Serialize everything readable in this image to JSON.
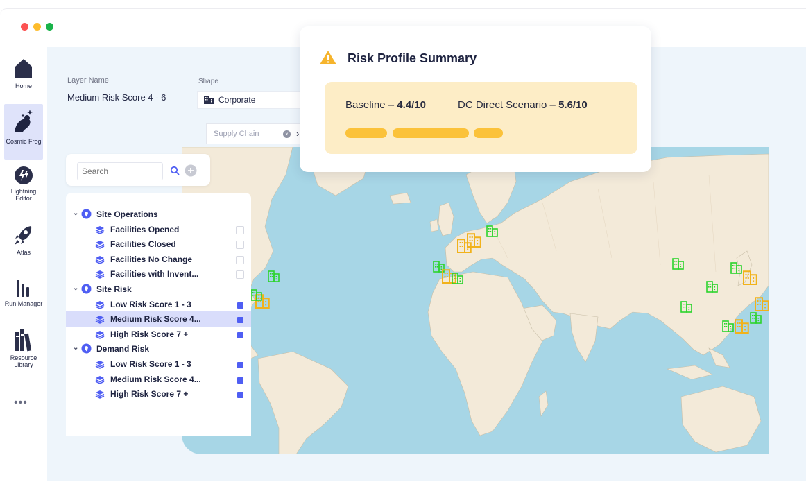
{
  "window": {
    "controls": [
      "close",
      "minimize",
      "maximize"
    ]
  },
  "colors": {
    "accent": "#4f5ef3",
    "warning": "#f6b42c",
    "risk_high": "#f1b21b",
    "risk_low": "#2bd42b",
    "summary_bg": "#fdedc6"
  },
  "sidebar": {
    "items": [
      {
        "label": "Home",
        "icon": "home-icon"
      },
      {
        "label": "Cosmic Frog",
        "icon": "cosmic-frog-icon",
        "active": true
      },
      {
        "label": "Lightning Editor",
        "icon": "lightning-icon"
      },
      {
        "label": "Atlas",
        "icon": "rocket-icon"
      },
      {
        "label": "Run Manager",
        "icon": "bar-chart-icon"
      },
      {
        "label": "Resource Library",
        "icon": "books-icon"
      }
    ],
    "more": "•••"
  },
  "layer_form": {
    "layer_name_label": "Layer Name",
    "layer_name_value": "Medium Risk Score 4 - 6",
    "shape_label": "Shape",
    "shape_value": "Corporate",
    "filter_chip": "Supply Chain"
  },
  "search": {
    "placeholder": "Search",
    "value": "Search"
  },
  "layers": {
    "groups": [
      {
        "label": "Site Operations",
        "items": [
          {
            "label": "Facilities Opened",
            "checked": false
          },
          {
            "label": "Facilities Closed",
            "checked": false
          },
          {
            "label": "Facilities No Change",
            "checked": false
          },
          {
            "label": "Facilities with Invent...",
            "checked": false
          }
        ]
      },
      {
        "label": "Site Risk",
        "items": [
          {
            "label": "Low Risk Score 1 - 3",
            "checked": true
          },
          {
            "label": "Medium Risk Score 4...",
            "checked": true,
            "selected": true
          },
          {
            "label": "High Risk Score 7 +",
            "checked": true
          }
        ]
      },
      {
        "label": "Demand Risk",
        "items": [
          {
            "label": "Low Risk Score 1 - 3",
            "checked": true
          },
          {
            "label": "Medium Risk Score 4...",
            "checked": true
          },
          {
            "label": "High Risk Score 7 +",
            "checked": true
          }
        ]
      }
    ]
  },
  "popup": {
    "title": "Risk Profile Summary",
    "baseline_label": "Baseline –",
    "baseline_value": "4.4/10",
    "scenario_label": "DC Direct Scenario –",
    "scenario_value": "5.6/10"
  },
  "map": {
    "markers": [
      {
        "region": "Europe",
        "risk": "low"
      },
      {
        "region": "Europe",
        "risk": "high"
      },
      {
        "region": "Europe",
        "risk": "high"
      },
      {
        "region": "Iberia",
        "risk": "low"
      },
      {
        "region": "Iberia",
        "risk": "high"
      },
      {
        "region": "Iberia",
        "risk": "low"
      },
      {
        "region": "North America",
        "risk": "low"
      },
      {
        "region": "North America",
        "risk": "high"
      },
      {
        "region": "North America",
        "risk": "low"
      },
      {
        "region": "Asia",
        "risk": "low"
      },
      {
        "region": "Asia",
        "risk": "low"
      },
      {
        "region": "Asia",
        "risk": "high"
      },
      {
        "region": "Asia",
        "risk": "low"
      },
      {
        "region": "Asia",
        "risk": "high"
      },
      {
        "region": "Asia",
        "risk": "low"
      },
      {
        "region": "Asia",
        "risk": "high"
      },
      {
        "region": "Asia",
        "risk": "low"
      },
      {
        "region": "Asia",
        "risk": "low"
      }
    ]
  }
}
